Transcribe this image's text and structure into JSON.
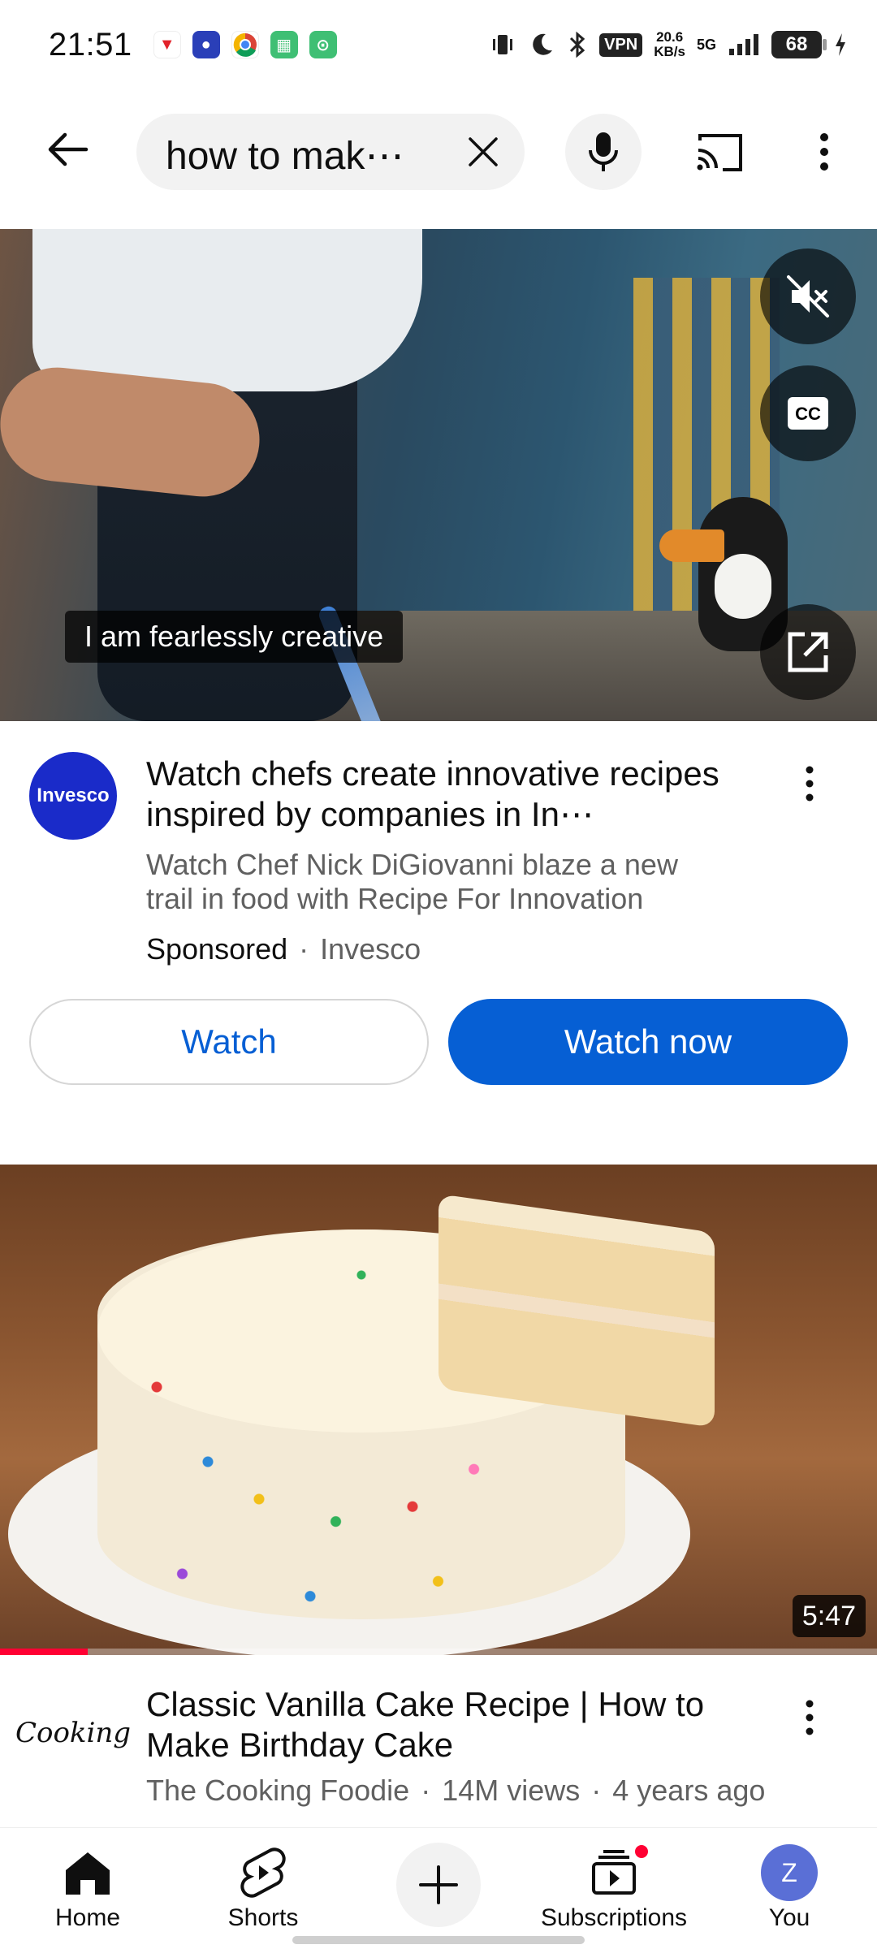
{
  "status_bar": {
    "time": "21:51",
    "vpn": "VPN",
    "speed_value": "20.6",
    "speed_unit": "KB/s",
    "network": "5G",
    "battery": "68"
  },
  "search": {
    "query": "how to mak⋯"
  },
  "ad": {
    "caption": "I am fearlessly creative",
    "advertiser_avatar_text": "Invesco",
    "title": "Watch chefs create innovative recipes inspired by companies in In⋯",
    "description": "Watch Chef Nick DiGiovanni blaze a new trail in food with Recipe For Innovation",
    "sponsored_label": "Sponsored",
    "separator": "·",
    "advertiser": "Invesco",
    "watch_label": "Watch",
    "watch_now_label": "Watch now"
  },
  "video": {
    "duration": "5:47",
    "progress_fraction": 0.1,
    "title": "Classic Vanilla Cake Recipe | How to Make Birthday Cake",
    "channel": "The Cooking Foodie",
    "views": "14M views",
    "age": "4 years ago",
    "separator": "·",
    "channel_avatar_text": "Cooking"
  },
  "bottom_nav": {
    "home": "Home",
    "shorts": "Shorts",
    "subscriptions": "Subscriptions",
    "you": "You",
    "you_avatar_letter": "Z"
  },
  "colors": {
    "accent_blue": "#065fd4",
    "youtube_red": "#ff0033",
    "secondary_text": "#606060"
  },
  "icons": [
    "back-arrow-icon",
    "close-icon",
    "mic-icon",
    "cast-icon",
    "more-vert-icon",
    "mute-icon",
    "cc-icon",
    "open-external-icon",
    "home-icon",
    "shorts-icon",
    "plus-icon",
    "subscriptions-icon"
  ]
}
